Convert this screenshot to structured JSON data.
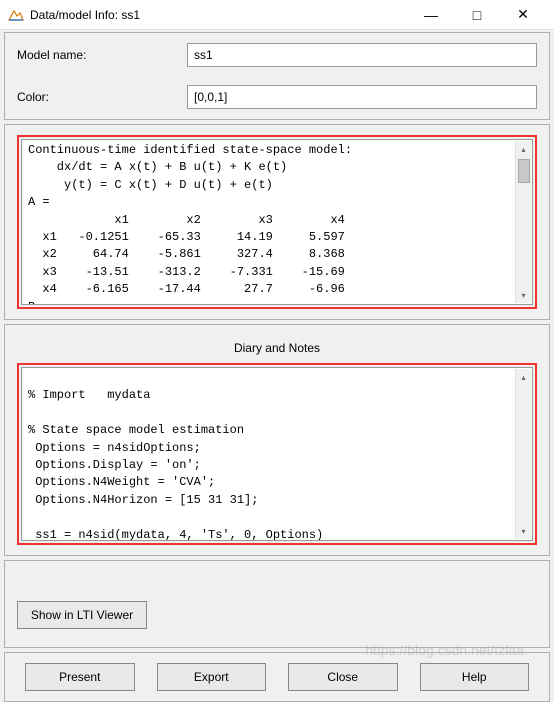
{
  "window": {
    "title": "Data/model Info: ss1",
    "minimize": "—",
    "maximize": "□",
    "close": "✕"
  },
  "top_panel": {
    "model_name_label": "Model name:",
    "model_name_value": "ss1",
    "color_label": "Color:",
    "color_value": "[0,0,1]"
  },
  "model_info_text": "Continuous-time identified state-space model:\n    dx/dt = A x(t) + B u(t) + K e(t)\n     y(t) = C x(t) + D u(t) + e(t)\nA =\n            x1        x2        x3        x4\n  x1   -0.1251    -65.33     14.19     5.597\n  x2     64.74    -5.861     327.4     8.368\n  x3    -13.51    -313.2    -7.331    -15.69\n  x4    -6.165    -17.44      27.7     -6.96\nB =",
  "diary": {
    "heading": "Diary and Notes",
    "text": "\n% Import   mydata\n\n% State space model estimation\n Options = n4sidOptions;\n Options.Display = 'on';\n Options.N4Weight = 'CVA';\n Options.N4Horizon = [15 31 31];\n\n ss1 = n4sid(mydata, 4, 'Ts', 0, Options)\n"
  },
  "lti_button": "Show in LTI Viewer",
  "bottom_buttons": {
    "present": "Present",
    "export": "Export",
    "close": "Close",
    "help": "Help"
  },
  "watermark": "https://blog.csdn.net/tzlaa"
}
